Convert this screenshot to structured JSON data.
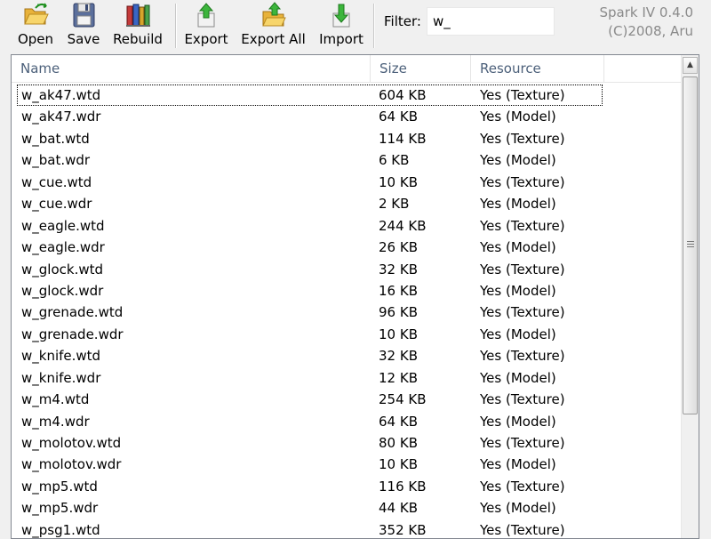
{
  "toolbar": {
    "buttons": [
      {
        "label": "Open",
        "icon": "folder-open-icon"
      },
      {
        "label": "Save",
        "icon": "floppy-disk-icon"
      },
      {
        "label": "Rebuild",
        "icon": "rebuild-books-icon"
      },
      {
        "label": "Export",
        "icon": "export-arrow-up-icon"
      },
      {
        "label": "Export All",
        "icon": "folder-export-all-icon"
      },
      {
        "label": "Import",
        "icon": "import-arrow-down-icon"
      }
    ],
    "filter_label": "Filter:",
    "filter_value": "w_",
    "brand_line1": "Spark IV 0.4.0",
    "brand_line2": "(C)2008, Aru"
  },
  "list": {
    "columns": [
      "Name",
      "Size",
      "Resource"
    ],
    "rows": [
      {
        "name": "w_ak47.wtd",
        "size": "604 KB",
        "resource": "Yes (Texture)"
      },
      {
        "name": "w_ak47.wdr",
        "size": "64 KB",
        "resource": "Yes (Model)"
      },
      {
        "name": "w_bat.wtd",
        "size": "114 KB",
        "resource": "Yes (Texture)"
      },
      {
        "name": "w_bat.wdr",
        "size": "6 KB",
        "resource": "Yes (Model)"
      },
      {
        "name": "w_cue.wtd",
        "size": "10 KB",
        "resource": "Yes (Texture)"
      },
      {
        "name": "w_cue.wdr",
        "size": "2 KB",
        "resource": "Yes (Model)"
      },
      {
        "name": "w_eagle.wtd",
        "size": "244 KB",
        "resource": "Yes (Texture)"
      },
      {
        "name": "w_eagle.wdr",
        "size": "26 KB",
        "resource": "Yes (Model)"
      },
      {
        "name": "w_glock.wtd",
        "size": "32 KB",
        "resource": "Yes (Texture)"
      },
      {
        "name": "w_glock.wdr",
        "size": "16 KB",
        "resource": "Yes (Model)"
      },
      {
        "name": "w_grenade.wtd",
        "size": "96 KB",
        "resource": "Yes (Texture)"
      },
      {
        "name": "w_grenade.wdr",
        "size": "10 KB",
        "resource": "Yes (Model)"
      },
      {
        "name": "w_knife.wtd",
        "size": "32 KB",
        "resource": "Yes (Texture)"
      },
      {
        "name": "w_knife.wdr",
        "size": "12 KB",
        "resource": "Yes (Model)"
      },
      {
        "name": "w_m4.wtd",
        "size": "254 KB",
        "resource": "Yes (Texture)"
      },
      {
        "name": "w_m4.wdr",
        "size": "64 KB",
        "resource": "Yes (Model)"
      },
      {
        "name": "w_molotov.wtd",
        "size": "80 KB",
        "resource": "Yes (Texture)"
      },
      {
        "name": "w_molotov.wdr",
        "size": "10 KB",
        "resource": "Yes (Model)"
      },
      {
        "name": "w_mp5.wtd",
        "size": "116 KB",
        "resource": "Yes (Texture)"
      },
      {
        "name": "w_mp5.wdr",
        "size": "44 KB",
        "resource": "Yes (Model)"
      },
      {
        "name": "w_psg1.wtd",
        "size": "352 KB",
        "resource": "Yes (Texture)"
      }
    ]
  },
  "colors": {
    "header_text": "#4c607a",
    "window_bg": "#f0f0f0",
    "list_bg": "#ffffff"
  }
}
